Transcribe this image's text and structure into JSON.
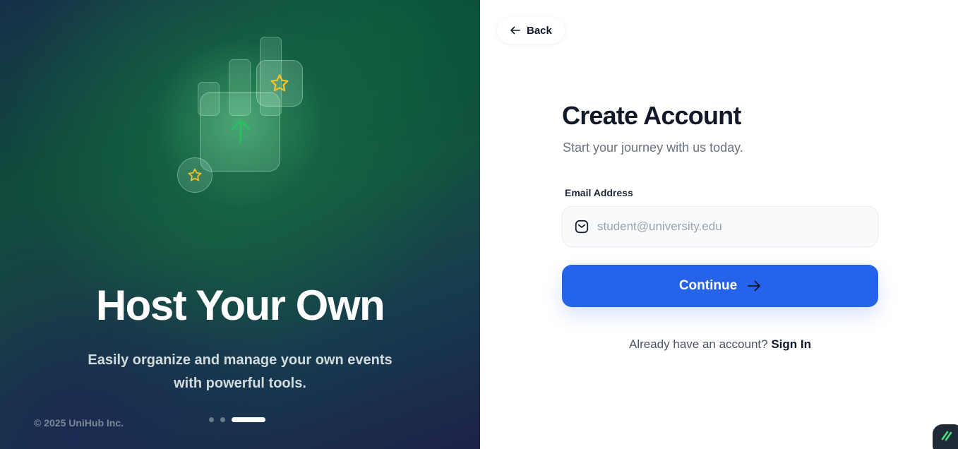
{
  "hero": {
    "title": "Host Your Own",
    "subtitle": "Easily organize and manage your own events with powerful tools.",
    "copyright": "© 2025 UniHub Inc.",
    "carousel": {
      "total": 3,
      "active_index": 2
    },
    "colors": {
      "star": "#f2c12e",
      "arrow": "#22c55e"
    }
  },
  "nav": {
    "back_label": "Back"
  },
  "form": {
    "title": "Create Account",
    "subtitle": "Start your journey with us today.",
    "email_label": "Email Address",
    "email_placeholder": "student@university.edu",
    "email_value": "",
    "continue_label": "Continue",
    "signin_prompt": "Already have an account?",
    "signin_link": "Sign In"
  },
  "colors": {
    "primary": "#2563eb",
    "heading": "#111827",
    "muted": "#6b7280"
  },
  "icons": [
    "arrow-left-icon",
    "mail-icon",
    "arrow-right-icon",
    "arrow-up-icon",
    "star-icon",
    "app-logo-icon"
  ]
}
